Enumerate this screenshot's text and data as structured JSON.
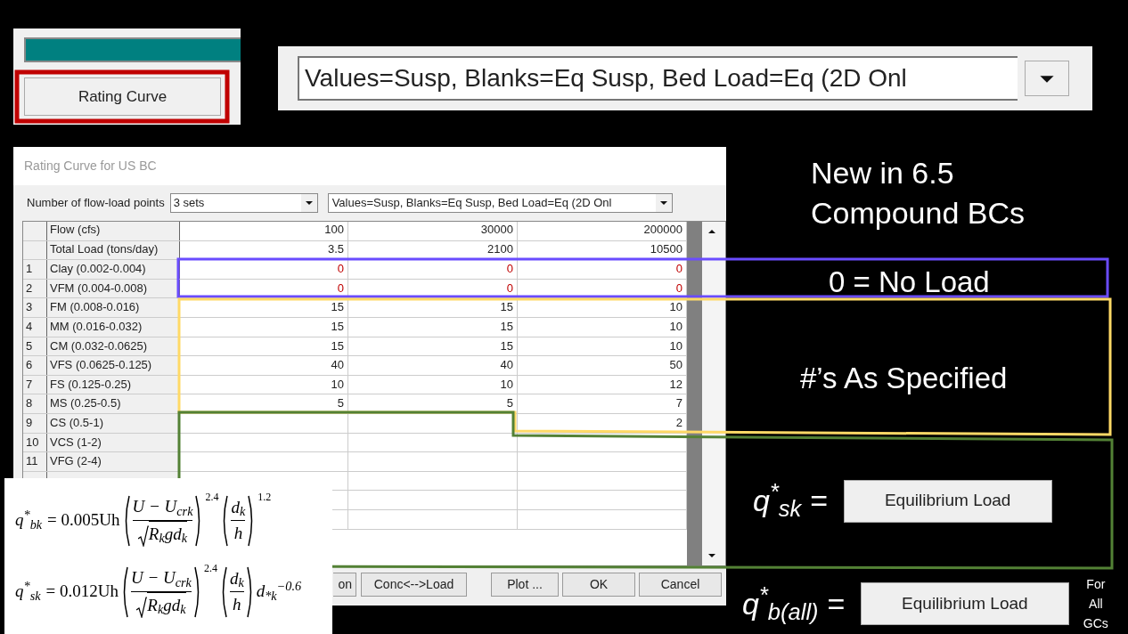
{
  "top_panel": {
    "button": "Rating Curve"
  },
  "top_dropdown": {
    "value": "Values=Susp, Blanks=Eq Susp, Bed Load=Eq (2D Onl"
  },
  "dialog": {
    "title": "Rating Curve for US BC",
    "points_label": "Number of flow-load points",
    "points_value": "3 sets",
    "mode_value": "Values=Susp, Blanks=Eq Susp, Bed Load=Eq (2D Onl",
    "header_rows": [
      {
        "label": "Flow (cfs)",
        "values": [
          "100",
          "30000",
          "200000"
        ]
      },
      {
        "label": "Total Load (tons/day)",
        "values": [
          "3.5",
          "2100",
          "10500"
        ]
      }
    ],
    "rows": [
      {
        "number": "1",
        "label": "Clay (0.002-0.004)",
        "values": [
          "0",
          "0",
          "0"
        ],
        "flagged": true
      },
      {
        "number": "2",
        "label": "VFM (0.004-0.008)",
        "values": [
          "0",
          "0",
          "0"
        ],
        "flagged": true
      },
      {
        "number": "3",
        "label": "FM (0.008-0.016)",
        "values": [
          "15",
          "15",
          "10"
        ],
        "flagged": false
      },
      {
        "number": "4",
        "label": "MM (0.016-0.032)",
        "values": [
          "15",
          "15",
          "10"
        ],
        "flagged": false
      },
      {
        "number": "5",
        "label": "CM (0.032-0.0625)",
        "values": [
          "15",
          "15",
          "10"
        ],
        "flagged": false
      },
      {
        "number": "6",
        "label": "VFS (0.0625-0.125)",
        "values": [
          "40",
          "40",
          "50"
        ],
        "flagged": false
      },
      {
        "number": "7",
        "label": "FS (0.125-0.25)",
        "values": [
          "10",
          "10",
          "12"
        ],
        "flagged": false
      },
      {
        "number": "8",
        "label": "MS (0.25-0.5)",
        "values": [
          "5",
          "5",
          "7"
        ],
        "flagged": false
      },
      {
        "number": "9",
        "label": "CS (0.5-1)",
        "values": [
          "2"
        ],
        "flagged": false
      },
      {
        "number": "10",
        "label": "VCS (1-2)"
      },
      {
        "number": "11",
        "label": "VFG (2-4)"
      }
    ],
    "buttons": [
      "on",
      "Conc<-->Load",
      "Plot ...",
      "OK",
      "Cancel"
    ]
  },
  "headline": [
    "New in 6.5",
    "Compound BCs"
  ],
  "zero_note": "0 = No Load",
  "specified_note": "#’s As Specified",
  "equilibrium": [
    {
      "symbol": "q$^{*}$$_{sk}$ =",
      "button": "Equilibrium Load"
    },
    {
      "symbol": "q$^{*}$$_{b(all)}$ =",
      "button": "Equilibrium Load",
      "note": [
        "For",
        "All",
        "GCs"
      ]
    }
  ],
  "formulas": [
    {
      "lhs": "q$^{*}$$_{bk}$",
      "coef": "= 0.005Uh",
      "num": "U − U$_{crk}$",
      "den": "R$_{k}$gd$_{k}$",
      "exp1": "2.4",
      "num2": "d$_{k}$",
      "den2": "h",
      "exp2": "1.2"
    },
    {
      "lhs": "q$^{*}$$_{sk}$",
      "coef": "= 0.012Uh",
      "num": "U − U$_{crk}$",
      "den": "R$_{k}$gd$_{k}$",
      "exp1": "2.4",
      "num2": "d$_{k}$",
      "den2": "h",
      "tail": "d$_{*k}$$^{−0.6}$"
    }
  ]
}
